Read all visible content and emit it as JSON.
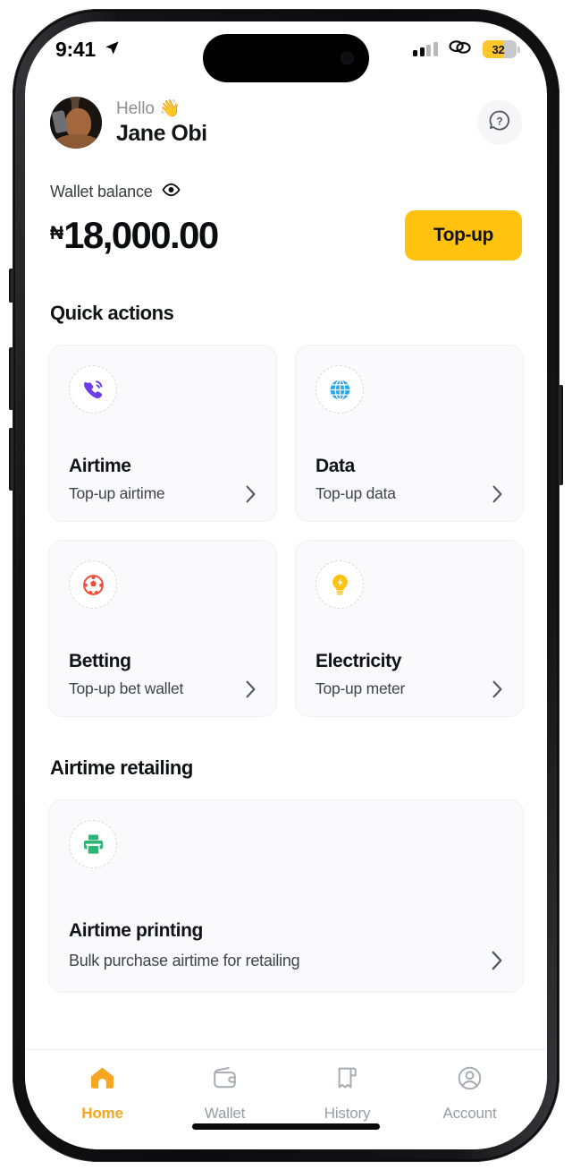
{
  "status_bar": {
    "time": "9:41",
    "location_icon": "location-arrow-icon",
    "signal_icon": "cellular-signal-icon",
    "link_icon": "chain-link-icon",
    "battery_level": "32",
    "battery_percent": 32
  },
  "header": {
    "greeting": "Hello 👋",
    "user_name": "Jane Obi",
    "avatar": "user-avatar",
    "help_icon": "help-chat-bubble-icon"
  },
  "wallet": {
    "label": "Wallet balance",
    "visibility_icon": "eye-icon",
    "currency_symbol": "₦",
    "amount": "18,000.00",
    "topup_label": "Top-up",
    "accent_color": "#FFC20E"
  },
  "quick_actions": {
    "title": "Quick actions",
    "items": [
      {
        "title": "Airtime",
        "subtitle": "Top-up airtime",
        "icon": "phone-call-icon",
        "icon_color": "#6C3CE9"
      },
      {
        "title": "Data",
        "subtitle": "Top-up data",
        "icon": "globe-icon",
        "icon_color": "#2BA6E8"
      },
      {
        "title": "Betting",
        "subtitle": "Top-up bet wallet",
        "icon": "soccer-ball-icon",
        "icon_color": "#F24C3D"
      },
      {
        "title": "Electricity",
        "subtitle": "Top-up meter",
        "icon": "lightbulb-icon",
        "icon_color": "#FFC20E"
      }
    ]
  },
  "airtime_retailing": {
    "title": "Airtime retailing",
    "card": {
      "title": "Airtime printing",
      "subtitle": "Bulk purchase airtime for retailing",
      "icon": "printer-icon",
      "icon_color": "#2BB673"
    }
  },
  "tab_bar": {
    "active": "Home",
    "active_color": "#F5A623",
    "items": [
      {
        "label": "Home",
        "icon": "home-icon"
      },
      {
        "label": "Wallet",
        "icon": "wallet-icon"
      },
      {
        "label": "History",
        "icon": "receipt-icon"
      },
      {
        "label": "Account",
        "icon": "person-circle-icon"
      }
    ]
  }
}
